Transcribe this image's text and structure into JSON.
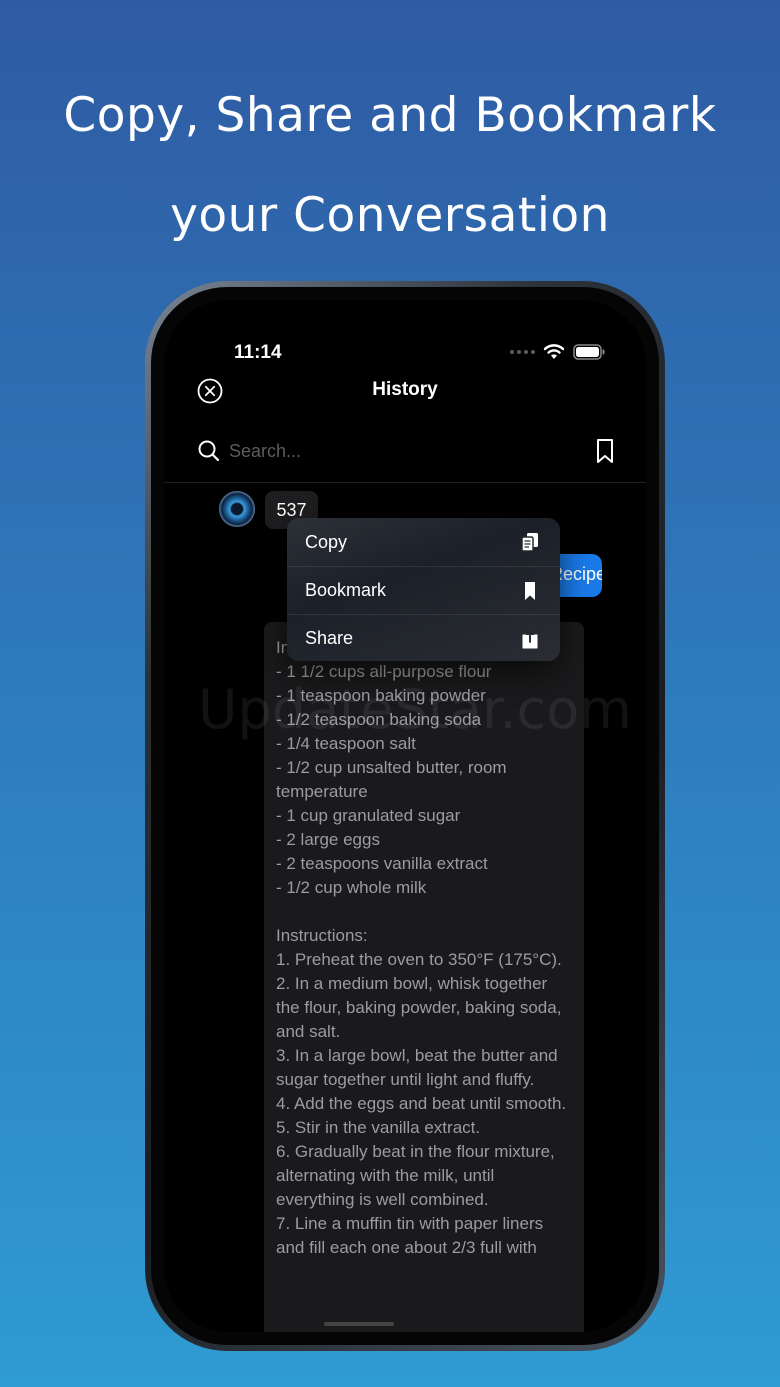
{
  "headline": {
    "line1": "Copy, Share and  Bookmark",
    "line2": "your Conversation"
  },
  "status_bar": {
    "time": "11:14"
  },
  "nav": {
    "title": "History"
  },
  "search": {
    "placeholder": "Search..."
  },
  "messages": {
    "user_label": "537",
    "blue_bubble_text": "Recipe",
    "reply_text": "Ingredients:\n- 1 1/2 cups all-purpose flour\n- 1 teaspoon baking powder\n- 1/2 teaspoon baking soda\n- 1/4 teaspoon salt\n- 1/2 cup unsalted butter, room temperature\n- 1 cup granulated sugar\n- 2 large eggs\n- 2 teaspoons vanilla extract\n- 1/2 cup whole milk\n\nInstructions:\n1. Preheat the oven to 350°F (175°C).\n2. In a medium bowl, whisk together the flour, baking powder, baking soda, and salt.\n3. In a large bowl, beat the butter and sugar together until light and fluffy.\n4. Add the eggs and beat until smooth.\n5. Stir in the vanilla extract.\n6. Gradually beat in the flour mixture, alternating with the milk, until everything is well combined.\n7. Line a muffin tin with paper liners and fill each one about 2/3 full with"
  },
  "context_menu": {
    "items": [
      {
        "label": "Copy",
        "icon": "copy-icon"
      },
      {
        "label": "Bookmark",
        "icon": "bookmark-icon"
      },
      {
        "label": "Share",
        "icon": "share-icon"
      }
    ]
  },
  "watermark": "UpdateStar.com",
  "colors": {
    "accent_blue": "#1a7ae8",
    "background_top": "#2f5ba3",
    "background_bottom": "#2f9bd3"
  }
}
